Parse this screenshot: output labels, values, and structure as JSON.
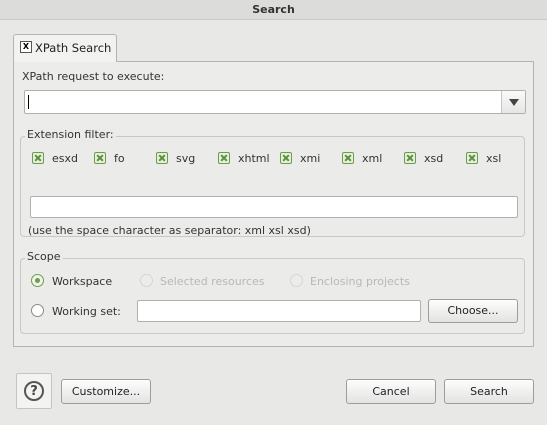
{
  "window": {
    "title": "Search"
  },
  "tab": {
    "label": "XPath Search",
    "icon": "xpath-icon",
    "icon_glyph": "X"
  },
  "xpath": {
    "label": "XPath request to execute:",
    "value": ""
  },
  "extension_filter": {
    "label": "Extension filter:",
    "items": [
      {
        "label": "esxd",
        "checked": true
      },
      {
        "label": "fo",
        "checked": true
      },
      {
        "label": "svg",
        "checked": true
      },
      {
        "label": "xhtml",
        "checked": true
      },
      {
        "label": "xmi",
        "checked": true
      },
      {
        "label": "xml",
        "checked": true
      },
      {
        "label": "xsd",
        "checked": true
      },
      {
        "label": "xsl",
        "checked": true
      }
    ],
    "field_value": "",
    "hint": "(use the space character as separator: xml xsl xsd)"
  },
  "scope": {
    "label": "Scope",
    "workspace": "Workspace",
    "selected_resources": "Selected resources",
    "enclosing_projects": "Enclosing projects",
    "working_set": "Working set:",
    "working_set_value": "",
    "choose": "Choose...",
    "selected": "Workspace"
  },
  "footer": {
    "help_glyph": "?",
    "customize": "Customize...",
    "cancel": "Cancel",
    "search": "Search"
  },
  "colors": {
    "check_accent": "#6f9a50",
    "background": "#e8e8e7"
  }
}
